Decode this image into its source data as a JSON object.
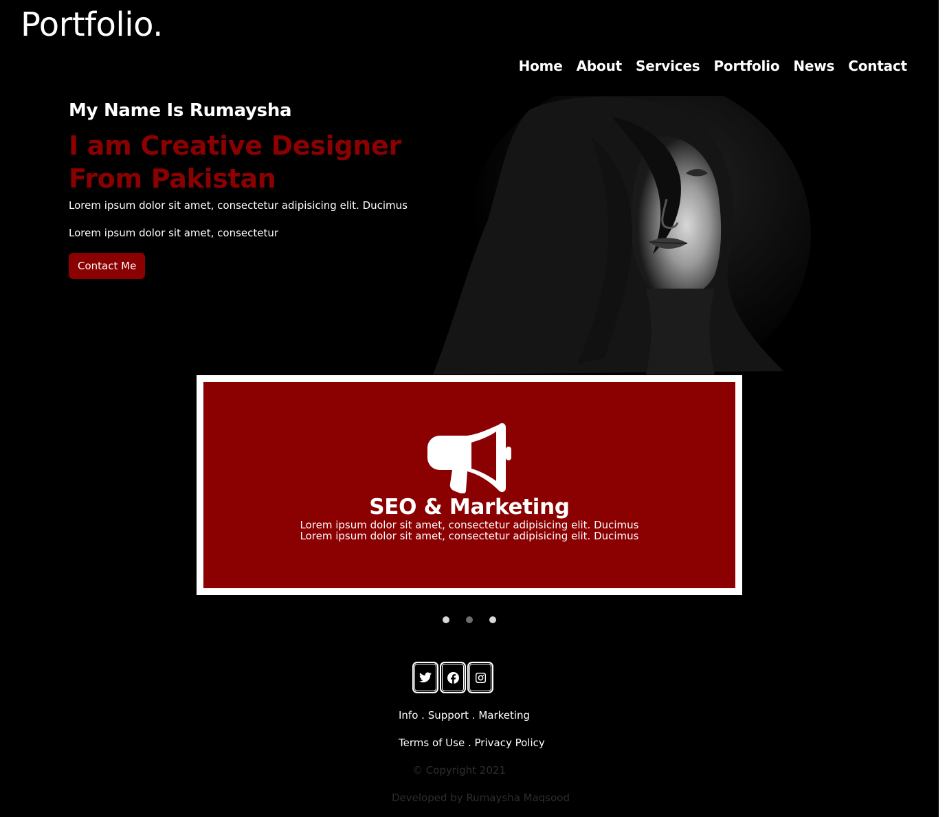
{
  "header": {
    "logo": "Portfolio.",
    "nav": [
      "Home",
      "About",
      "Services",
      "Portfolio",
      "News",
      "Contact"
    ]
  },
  "hero": {
    "name": "My Name Is Rumaysha",
    "title_line1": "I am Creative Designer",
    "title_line2": "From Pakistan",
    "paragraph1": "Lorem ipsum dolor sit amet, consectetur adipisicing elit. Ducimus",
    "paragraph2": "Lorem ipsum dolor sit amet, consectetur",
    "button": "Contact Me",
    "image": "portrait-photo"
  },
  "service_card": {
    "icon": "megaphone-icon",
    "title": "SEO & Marketing",
    "line1": "Lorem ipsum dolor sit amet, consectetur adipisicing elit. Ducimus",
    "line2": "Lorem ipsum dolor sit amet, consectetur adipisicing elit. Ducimus"
  },
  "carousel": {
    "slides": 3,
    "active_index": 1
  },
  "footer": {
    "social": [
      "twitter-icon",
      "facebook-icon",
      "instagram-icon"
    ],
    "links1": [
      "Info",
      "Support",
      "Marketing"
    ],
    "links2": [
      "Terms of Use",
      "Privacy Policy"
    ],
    "separator": " . ",
    "copyright": "© Copyright 2021",
    "developed_by": "Developed by Rumaysha Maqsood"
  },
  "colors": {
    "background": "#000000",
    "accent": "#8b0000",
    "text": "#ffffff",
    "muted": "#2e2e2e"
  }
}
